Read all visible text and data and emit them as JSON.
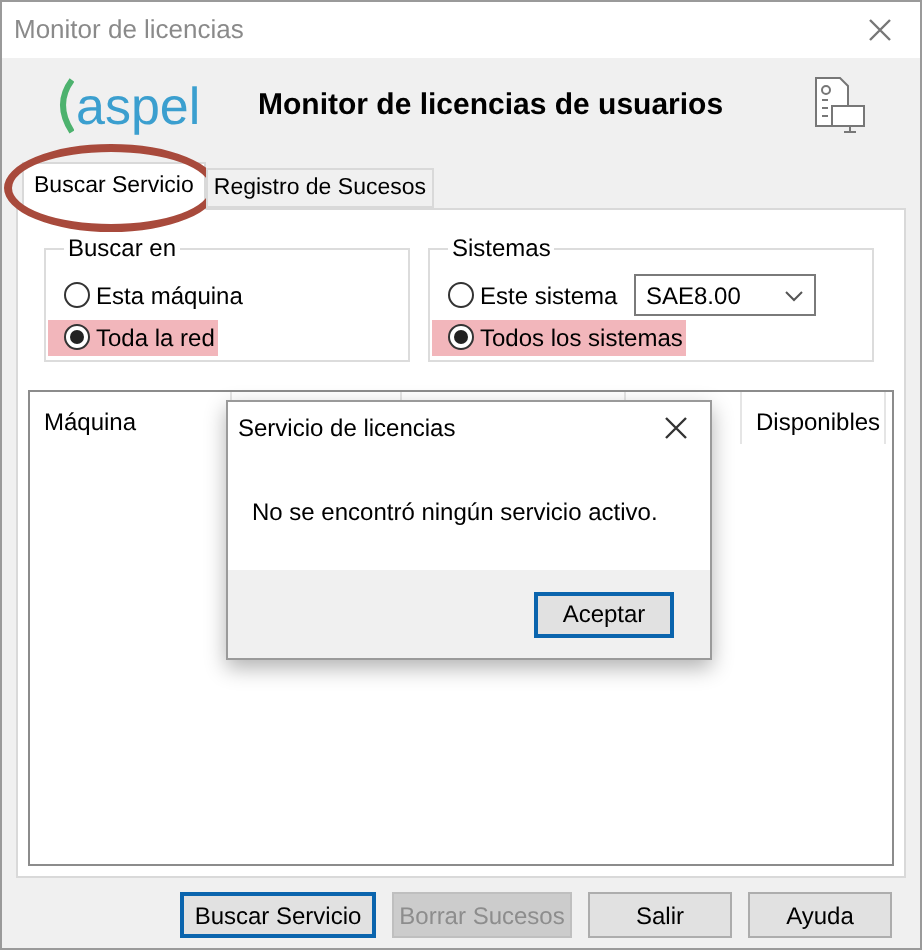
{
  "window": {
    "title": "Monitor de licencias"
  },
  "logo": {
    "text": "aspel"
  },
  "header": {
    "title": "Monitor de licencias de usuarios"
  },
  "tabs": [
    {
      "label": "Buscar Servicio",
      "selected": true,
      "circled": true
    },
    {
      "label": "Registro de Sucesos",
      "selected": false,
      "circled": false
    }
  ],
  "groups": [
    {
      "title": "Buscar en",
      "options": [
        {
          "label": "Esta máquina",
          "selected": false,
          "highlighted": false
        },
        {
          "label": "Toda la red",
          "selected": true,
          "highlighted": true
        }
      ]
    },
    {
      "title": "Sistemas",
      "options": [
        {
          "label": "Este sistema",
          "selected": false,
          "highlighted": false
        },
        {
          "label": "Todos los sistemas",
          "selected": true,
          "highlighted": true
        }
      ],
      "dropdown": {
        "value": "SAE8.00"
      }
    }
  ],
  "table": {
    "columns": [
      "Máquina",
      "Disponibles"
    ]
  },
  "buttons": [
    {
      "label": "Buscar Servicio",
      "disabled": false,
      "default": true
    },
    {
      "label": "Borrar Sucesos",
      "disabled": true,
      "default": false
    },
    {
      "label": "Salir",
      "disabled": false,
      "default": false
    },
    {
      "label": "Ayuda",
      "disabled": false,
      "default": false
    }
  ],
  "dialog": {
    "title": "Servicio de licencias",
    "message": "No se encontró ningún servicio activo.",
    "button": {
      "label": "Aceptar",
      "default": true
    }
  }
}
